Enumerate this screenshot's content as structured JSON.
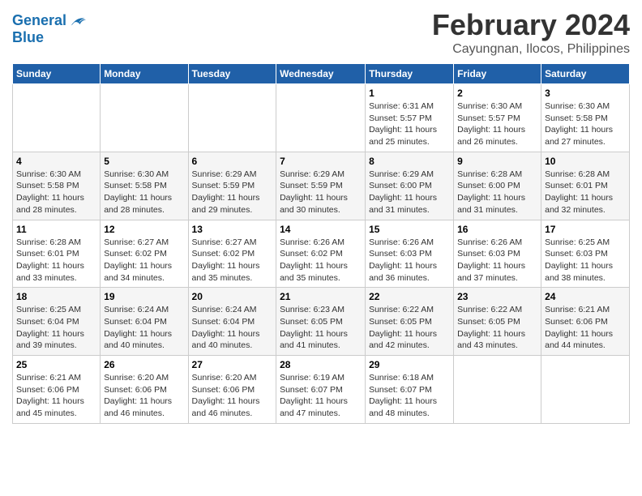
{
  "header": {
    "logo_line1": "General",
    "logo_line2": "Blue",
    "title": "February 2024",
    "subtitle": "Cayungnan, Ilocos, Philippines"
  },
  "weekdays": [
    "Sunday",
    "Monday",
    "Tuesday",
    "Wednesday",
    "Thursday",
    "Friday",
    "Saturday"
  ],
  "weeks": [
    [
      {
        "day": "",
        "info": ""
      },
      {
        "day": "",
        "info": ""
      },
      {
        "day": "",
        "info": ""
      },
      {
        "day": "",
        "info": ""
      },
      {
        "day": "1",
        "info": "Sunrise: 6:31 AM\nSunset: 5:57 PM\nDaylight: 11 hours and 25 minutes."
      },
      {
        "day": "2",
        "info": "Sunrise: 6:30 AM\nSunset: 5:57 PM\nDaylight: 11 hours and 26 minutes."
      },
      {
        "day": "3",
        "info": "Sunrise: 6:30 AM\nSunset: 5:58 PM\nDaylight: 11 hours and 27 minutes."
      }
    ],
    [
      {
        "day": "4",
        "info": "Sunrise: 6:30 AM\nSunset: 5:58 PM\nDaylight: 11 hours and 28 minutes."
      },
      {
        "day": "5",
        "info": "Sunrise: 6:30 AM\nSunset: 5:58 PM\nDaylight: 11 hours and 28 minutes."
      },
      {
        "day": "6",
        "info": "Sunrise: 6:29 AM\nSunset: 5:59 PM\nDaylight: 11 hours and 29 minutes."
      },
      {
        "day": "7",
        "info": "Sunrise: 6:29 AM\nSunset: 5:59 PM\nDaylight: 11 hours and 30 minutes."
      },
      {
        "day": "8",
        "info": "Sunrise: 6:29 AM\nSunset: 6:00 PM\nDaylight: 11 hours and 31 minutes."
      },
      {
        "day": "9",
        "info": "Sunrise: 6:28 AM\nSunset: 6:00 PM\nDaylight: 11 hours and 31 minutes."
      },
      {
        "day": "10",
        "info": "Sunrise: 6:28 AM\nSunset: 6:01 PM\nDaylight: 11 hours and 32 minutes."
      }
    ],
    [
      {
        "day": "11",
        "info": "Sunrise: 6:28 AM\nSunset: 6:01 PM\nDaylight: 11 hours and 33 minutes."
      },
      {
        "day": "12",
        "info": "Sunrise: 6:27 AM\nSunset: 6:02 PM\nDaylight: 11 hours and 34 minutes."
      },
      {
        "day": "13",
        "info": "Sunrise: 6:27 AM\nSunset: 6:02 PM\nDaylight: 11 hours and 35 minutes."
      },
      {
        "day": "14",
        "info": "Sunrise: 6:26 AM\nSunset: 6:02 PM\nDaylight: 11 hours and 35 minutes."
      },
      {
        "day": "15",
        "info": "Sunrise: 6:26 AM\nSunset: 6:03 PM\nDaylight: 11 hours and 36 minutes."
      },
      {
        "day": "16",
        "info": "Sunrise: 6:26 AM\nSunset: 6:03 PM\nDaylight: 11 hours and 37 minutes."
      },
      {
        "day": "17",
        "info": "Sunrise: 6:25 AM\nSunset: 6:03 PM\nDaylight: 11 hours and 38 minutes."
      }
    ],
    [
      {
        "day": "18",
        "info": "Sunrise: 6:25 AM\nSunset: 6:04 PM\nDaylight: 11 hours and 39 minutes."
      },
      {
        "day": "19",
        "info": "Sunrise: 6:24 AM\nSunset: 6:04 PM\nDaylight: 11 hours and 40 minutes."
      },
      {
        "day": "20",
        "info": "Sunrise: 6:24 AM\nSunset: 6:04 PM\nDaylight: 11 hours and 40 minutes."
      },
      {
        "day": "21",
        "info": "Sunrise: 6:23 AM\nSunset: 6:05 PM\nDaylight: 11 hours and 41 minutes."
      },
      {
        "day": "22",
        "info": "Sunrise: 6:22 AM\nSunset: 6:05 PM\nDaylight: 11 hours and 42 minutes."
      },
      {
        "day": "23",
        "info": "Sunrise: 6:22 AM\nSunset: 6:05 PM\nDaylight: 11 hours and 43 minutes."
      },
      {
        "day": "24",
        "info": "Sunrise: 6:21 AM\nSunset: 6:06 PM\nDaylight: 11 hours and 44 minutes."
      }
    ],
    [
      {
        "day": "25",
        "info": "Sunrise: 6:21 AM\nSunset: 6:06 PM\nDaylight: 11 hours and 45 minutes."
      },
      {
        "day": "26",
        "info": "Sunrise: 6:20 AM\nSunset: 6:06 PM\nDaylight: 11 hours and 46 minutes."
      },
      {
        "day": "27",
        "info": "Sunrise: 6:20 AM\nSunset: 6:06 PM\nDaylight: 11 hours and 46 minutes."
      },
      {
        "day": "28",
        "info": "Sunrise: 6:19 AM\nSunset: 6:07 PM\nDaylight: 11 hours and 47 minutes."
      },
      {
        "day": "29",
        "info": "Sunrise: 6:18 AM\nSunset: 6:07 PM\nDaylight: 11 hours and 48 minutes."
      },
      {
        "day": "",
        "info": ""
      },
      {
        "day": "",
        "info": ""
      }
    ]
  ]
}
